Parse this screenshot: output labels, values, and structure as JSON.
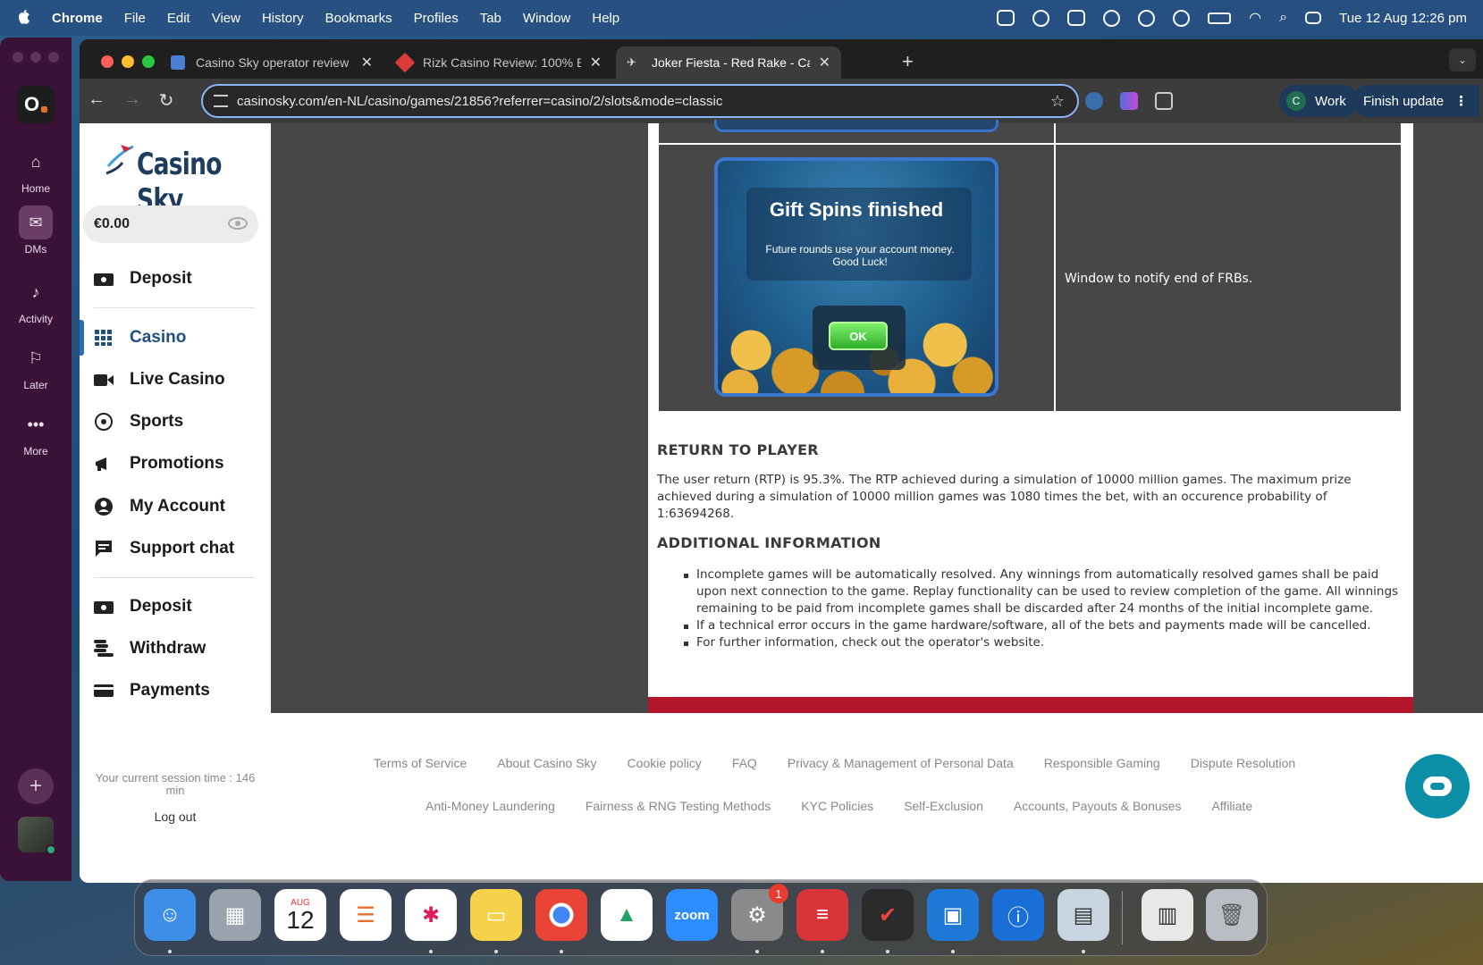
{
  "menubar": {
    "app": "Chrome",
    "items": [
      "File",
      "Edit",
      "View",
      "History",
      "Bookmarks",
      "Profiles",
      "Tab",
      "Window",
      "Help"
    ],
    "clock": "Tue 12 Aug  12:26 pm"
  },
  "rail": {
    "workspace_initial": "O",
    "items": [
      {
        "label": "Home",
        "icon": "home-icon"
      },
      {
        "label": "DMs",
        "icon": "dms-icon"
      },
      {
        "label": "Activity",
        "icon": "bell-icon"
      },
      {
        "label": "Later",
        "icon": "bookmark-icon"
      },
      {
        "label": "More",
        "icon": "more-icon"
      }
    ]
  },
  "tabs": [
    {
      "title": "Casino Sky operator review -",
      "color": "#4a7fd4"
    },
    {
      "title": "Rizk Casino Review: 100% Bo",
      "color": "#d93b3b"
    },
    {
      "title": "Joker Fiesta - Red Rake - Cas",
      "color": "#cccccc"
    }
  ],
  "address": {
    "url": "casinosky.com/en-NL/casino/games/21856?referrer=casino/2/slots&mode=classic"
  },
  "toolbar": {
    "profile_initial": "C",
    "profile_name": "Work",
    "update_label": "Finish update"
  },
  "site": {
    "logo_text": "Casino Sky",
    "balance": "€0.00",
    "nav_top": [
      {
        "label": "Deposit",
        "icon": "wallet-icon"
      }
    ],
    "nav_main": [
      {
        "label": "Casino",
        "icon": "grid-icon",
        "active": true
      },
      {
        "label": "Live Casino",
        "icon": "video-icon"
      },
      {
        "label": "Sports",
        "icon": "soccer-ball-icon"
      },
      {
        "label": "Promotions",
        "icon": "megaphone-icon"
      },
      {
        "label": "My Account",
        "icon": "user-circle-icon"
      },
      {
        "label": "Support chat",
        "icon": "chat-icon"
      }
    ],
    "nav_bottom": [
      {
        "label": "Deposit",
        "icon": "wallet-icon"
      },
      {
        "label": "Withdraw",
        "icon": "coins-icon"
      },
      {
        "label": "Payments",
        "icon": "card-icon"
      }
    ],
    "session_text": "Your current session time : 146 min",
    "logout": "Log out"
  },
  "doc": {
    "popup_title": "Gift Spins finished",
    "popup_text": "Future rounds use your account money. Good Luck!",
    "popup_ok": "OK",
    "cell_desc": "Window to notify end of FRBs.",
    "rtp_heading": "RETURN TO PLAYER",
    "rtp_text": "The user return (RTP) is 95.3%. The RTP achieved during a simulation of 10000 million games. The maximum prize achieved during a simulation of 10000 million games was 1080 times the bet, with an occurence probability of 1:63694268.",
    "info_heading": "ADDITIONAL INFORMATION",
    "bullets": [
      "Incomplete games will be automatically resolved. Any winnings from automatically resolved games shall be paid upon next connection to the game. Replay functionality can be used to review completion of the game. All winnings remaining to be paid from incomplete games shall be discarded after 24 months of the initial incomplete game.",
      "If a technical error occurs in the game hardware/software, all of the bets and payments made will be cancelled.",
      "For further information, check out the operator's website."
    ]
  },
  "footer": {
    "row1": [
      "Terms of Service",
      "About Casino Sky",
      "Cookie policy",
      "FAQ",
      "Privacy & Management of Personal Data",
      "Responsible Gaming",
      "Dispute Resolution"
    ],
    "row2": [
      "Anti-Money Laundering",
      "Fairness & RNG Testing Methods",
      "KYC Policies",
      "Self-Exclusion",
      "Accounts, Payouts & Bonuses",
      "Affiliate"
    ]
  },
  "dock": {
    "items": [
      {
        "name": "finder",
        "color": "#3d8ee6",
        "glyph": "☺"
      },
      {
        "name": "launchpad",
        "color": "#9aa3ad",
        "glyph": "▦"
      },
      {
        "name": "calendar",
        "color": "#ffffff",
        "glyph": "12",
        "month": "AUG"
      },
      {
        "name": "reminders",
        "color": "#ffffff",
        "glyph": "☰"
      },
      {
        "name": "slack",
        "color": "#ffffff",
        "glyph": "✱"
      },
      {
        "name": "notes",
        "color": "#f5d24a",
        "glyph": "▭"
      },
      {
        "name": "chrome",
        "color": "#e6e6e6",
        "glyph": "◉"
      },
      {
        "name": "drive",
        "color": "#ffffff",
        "glyph": "▲"
      },
      {
        "name": "zoom",
        "color": "#2d8cff",
        "glyph": "zoom"
      },
      {
        "name": "system-settings",
        "color": "#8a8a8a",
        "glyph": "⚙",
        "badge": "1"
      },
      {
        "name": "expressvpn",
        "color": "#d9343a",
        "glyph": "≡"
      },
      {
        "name": "todo",
        "color": "#2b2b2b",
        "glyph": "✔"
      },
      {
        "name": "remote-desktop",
        "color": "#1e78d6",
        "glyph": "▣"
      },
      {
        "name": "1password",
        "color": "#1a6fd6",
        "glyph": "ⓘ"
      },
      {
        "name": "preview",
        "color": "#c8d4e0",
        "glyph": "▤"
      },
      {
        "name": "scanner",
        "color": "#e8e8e8",
        "glyph": "▥"
      },
      {
        "name": "trash",
        "color": "#b8bec4",
        "glyph": "🗑"
      }
    ]
  }
}
